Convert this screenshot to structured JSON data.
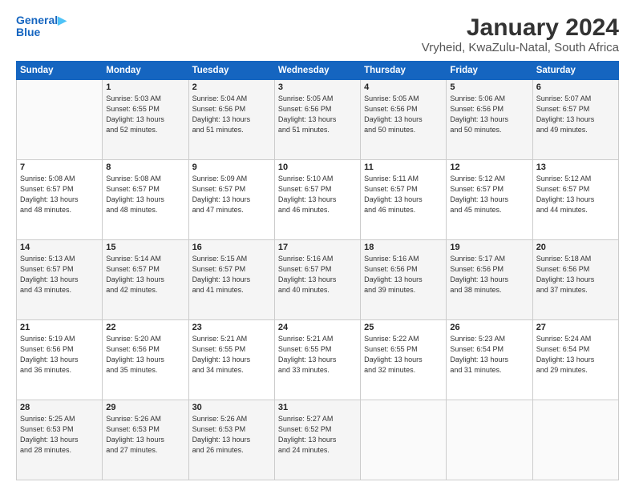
{
  "header": {
    "logo_line1": "General",
    "logo_line2": "Blue",
    "title": "January 2024",
    "subtitle": "Vryheid, KwaZulu-Natal, South Africa"
  },
  "days_of_week": [
    "Sunday",
    "Monday",
    "Tuesday",
    "Wednesday",
    "Thursday",
    "Friday",
    "Saturday"
  ],
  "weeks": [
    [
      {
        "day": "",
        "info": ""
      },
      {
        "day": "1",
        "info": "Sunrise: 5:03 AM\nSunset: 6:55 PM\nDaylight: 13 hours\nand 52 minutes."
      },
      {
        "day": "2",
        "info": "Sunrise: 5:04 AM\nSunset: 6:56 PM\nDaylight: 13 hours\nand 51 minutes."
      },
      {
        "day": "3",
        "info": "Sunrise: 5:05 AM\nSunset: 6:56 PM\nDaylight: 13 hours\nand 51 minutes."
      },
      {
        "day": "4",
        "info": "Sunrise: 5:05 AM\nSunset: 6:56 PM\nDaylight: 13 hours\nand 50 minutes."
      },
      {
        "day": "5",
        "info": "Sunrise: 5:06 AM\nSunset: 6:56 PM\nDaylight: 13 hours\nand 50 minutes."
      },
      {
        "day": "6",
        "info": "Sunrise: 5:07 AM\nSunset: 6:57 PM\nDaylight: 13 hours\nand 49 minutes."
      }
    ],
    [
      {
        "day": "7",
        "info": "Sunrise: 5:08 AM\nSunset: 6:57 PM\nDaylight: 13 hours\nand 48 minutes."
      },
      {
        "day": "8",
        "info": "Sunrise: 5:08 AM\nSunset: 6:57 PM\nDaylight: 13 hours\nand 48 minutes."
      },
      {
        "day": "9",
        "info": "Sunrise: 5:09 AM\nSunset: 6:57 PM\nDaylight: 13 hours\nand 47 minutes."
      },
      {
        "day": "10",
        "info": "Sunrise: 5:10 AM\nSunset: 6:57 PM\nDaylight: 13 hours\nand 46 minutes."
      },
      {
        "day": "11",
        "info": "Sunrise: 5:11 AM\nSunset: 6:57 PM\nDaylight: 13 hours\nand 46 minutes."
      },
      {
        "day": "12",
        "info": "Sunrise: 5:12 AM\nSunset: 6:57 PM\nDaylight: 13 hours\nand 45 minutes."
      },
      {
        "day": "13",
        "info": "Sunrise: 5:12 AM\nSunset: 6:57 PM\nDaylight: 13 hours\nand 44 minutes."
      }
    ],
    [
      {
        "day": "14",
        "info": "Sunrise: 5:13 AM\nSunset: 6:57 PM\nDaylight: 13 hours\nand 43 minutes."
      },
      {
        "day": "15",
        "info": "Sunrise: 5:14 AM\nSunset: 6:57 PM\nDaylight: 13 hours\nand 42 minutes."
      },
      {
        "day": "16",
        "info": "Sunrise: 5:15 AM\nSunset: 6:57 PM\nDaylight: 13 hours\nand 41 minutes."
      },
      {
        "day": "17",
        "info": "Sunrise: 5:16 AM\nSunset: 6:57 PM\nDaylight: 13 hours\nand 40 minutes."
      },
      {
        "day": "18",
        "info": "Sunrise: 5:16 AM\nSunset: 6:56 PM\nDaylight: 13 hours\nand 39 minutes."
      },
      {
        "day": "19",
        "info": "Sunrise: 5:17 AM\nSunset: 6:56 PM\nDaylight: 13 hours\nand 38 minutes."
      },
      {
        "day": "20",
        "info": "Sunrise: 5:18 AM\nSunset: 6:56 PM\nDaylight: 13 hours\nand 37 minutes."
      }
    ],
    [
      {
        "day": "21",
        "info": "Sunrise: 5:19 AM\nSunset: 6:56 PM\nDaylight: 13 hours\nand 36 minutes."
      },
      {
        "day": "22",
        "info": "Sunrise: 5:20 AM\nSunset: 6:56 PM\nDaylight: 13 hours\nand 35 minutes."
      },
      {
        "day": "23",
        "info": "Sunrise: 5:21 AM\nSunset: 6:55 PM\nDaylight: 13 hours\nand 34 minutes."
      },
      {
        "day": "24",
        "info": "Sunrise: 5:21 AM\nSunset: 6:55 PM\nDaylight: 13 hours\nand 33 minutes."
      },
      {
        "day": "25",
        "info": "Sunrise: 5:22 AM\nSunset: 6:55 PM\nDaylight: 13 hours\nand 32 minutes."
      },
      {
        "day": "26",
        "info": "Sunrise: 5:23 AM\nSunset: 6:54 PM\nDaylight: 13 hours\nand 31 minutes."
      },
      {
        "day": "27",
        "info": "Sunrise: 5:24 AM\nSunset: 6:54 PM\nDaylight: 13 hours\nand 29 minutes."
      }
    ],
    [
      {
        "day": "28",
        "info": "Sunrise: 5:25 AM\nSunset: 6:53 PM\nDaylight: 13 hours\nand 28 minutes."
      },
      {
        "day": "29",
        "info": "Sunrise: 5:26 AM\nSunset: 6:53 PM\nDaylight: 13 hours\nand 27 minutes."
      },
      {
        "day": "30",
        "info": "Sunrise: 5:26 AM\nSunset: 6:53 PM\nDaylight: 13 hours\nand 26 minutes."
      },
      {
        "day": "31",
        "info": "Sunrise: 5:27 AM\nSunset: 6:52 PM\nDaylight: 13 hours\nand 24 minutes."
      },
      {
        "day": "",
        "info": ""
      },
      {
        "day": "",
        "info": ""
      },
      {
        "day": "",
        "info": ""
      }
    ]
  ]
}
